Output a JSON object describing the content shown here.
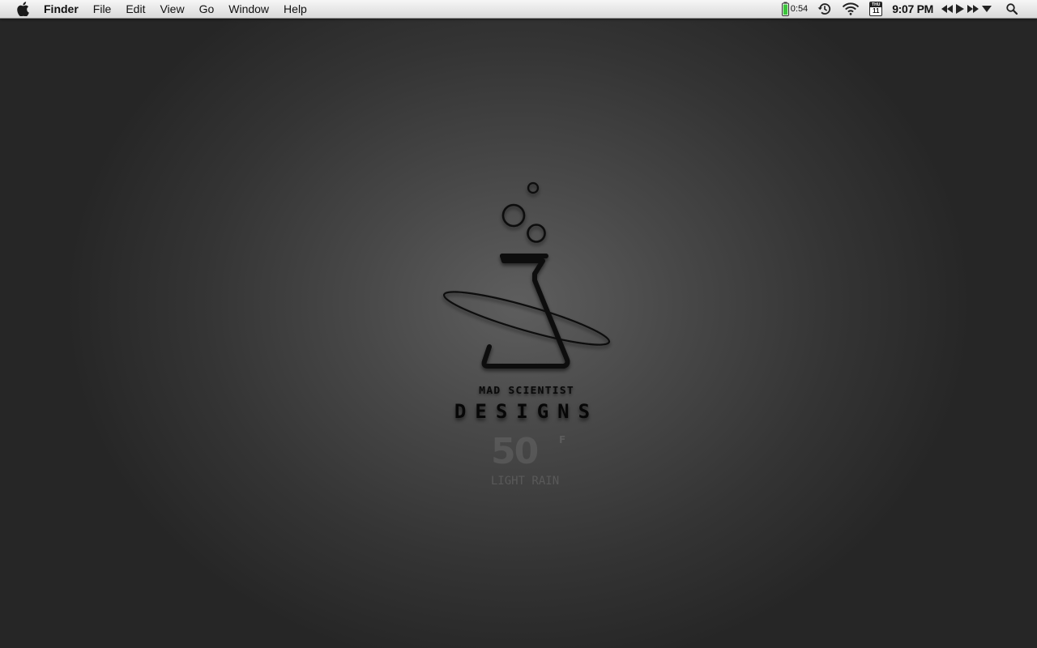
{
  "menubar": {
    "apple_icon": "apple-logo-icon",
    "app_name": "Finder",
    "menus": [
      "File",
      "Edit",
      "View",
      "Go",
      "Window",
      "Help"
    ],
    "status": {
      "battery_time": "0:54",
      "battery_icon": "battery-charging-icon",
      "time_machine_icon": "time-machine-icon",
      "wifi_icon": "wifi-icon",
      "calendar_day": "THU",
      "calendar_date": "11",
      "clock": "9:07 PM",
      "media_prev_icon": "rewind-icon",
      "media_play_icon": "play-icon",
      "media_next_icon": "fast-forward-icon",
      "media_menu_icon": "triangle-down-icon",
      "spotlight_icon": "search-icon"
    }
  },
  "desktop": {
    "logo_icon": "flask-logo-icon",
    "brand_line1": "MAD SCIENTIST",
    "brand_line2": "DESIGNS",
    "weather_temp": "50",
    "weather_unit": "F",
    "weather_condition": "LIGHT RAIN"
  },
  "colors": {
    "menubar_top": "#f6f6f6",
    "menubar_bottom": "#dadada",
    "desktop_center": "#5e5e5e",
    "desktop_edge": "#262626",
    "battery_green": "#3cc43c"
  }
}
